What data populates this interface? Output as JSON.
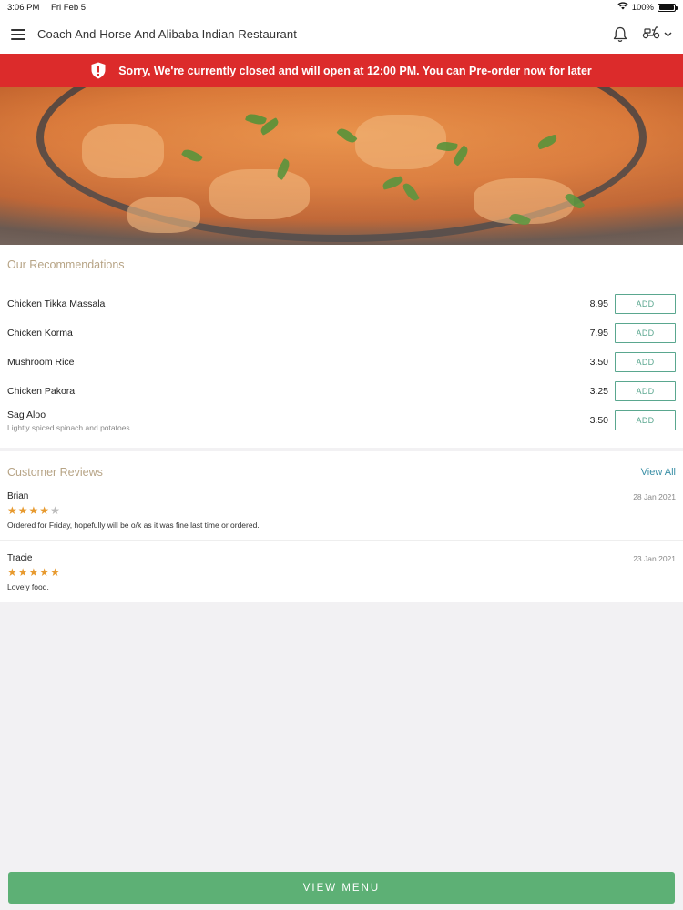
{
  "status_bar": {
    "time": "3:06 PM",
    "date": "Fri Feb 5",
    "battery": "100%"
  },
  "header": {
    "title": "Coach And Horse And Alibaba Indian Restaurant"
  },
  "banner": {
    "message": "Sorry, We're currently closed and will open at 12:00 PM. You can Pre-order now for later"
  },
  "recommendations": {
    "title": "Our Recommendations",
    "add_label": "ADD",
    "items": [
      {
        "name": "Chicken Tikka Massala",
        "description": "",
        "price": "8.95"
      },
      {
        "name": "Chicken Korma",
        "description": "",
        "price": "7.95"
      },
      {
        "name": "Mushroom Rice",
        "description": "",
        "price": "3.50"
      },
      {
        "name": "Chicken Pakora",
        "description": "",
        "price": "3.25"
      },
      {
        "name": "Sag Aloo",
        "description": "Lightly spiced spinach and potatoes",
        "price": "3.50"
      }
    ]
  },
  "reviews": {
    "title": "Customer Reviews",
    "view_all": "View All",
    "items": [
      {
        "name": "Brian",
        "date": "28 Jan 2021",
        "rating": 4,
        "text": "Ordered for Friday, hopefully will be o/k as it was fine last time or ordered."
      },
      {
        "name": "Tracie",
        "date": "23 Jan 2021",
        "rating": 5,
        "text": "Lovely food."
      }
    ]
  },
  "footer": {
    "view_menu": "VIEW MENU"
  },
  "colors": {
    "banner": "#dc2b2b",
    "accent_green": "#5db075",
    "add_border": "#5aa78f",
    "star": "#e79a2f",
    "section_title": "#b7a486",
    "link": "#3a8fa6"
  },
  "icons": {
    "menu": "hamburger-icon",
    "notifications": "bell-icon",
    "delivery": "scooter-icon",
    "dropdown": "chevron-down-icon",
    "banner": "shield-alert-icon",
    "wifi": "wifi-icon",
    "battery": "battery-icon"
  }
}
